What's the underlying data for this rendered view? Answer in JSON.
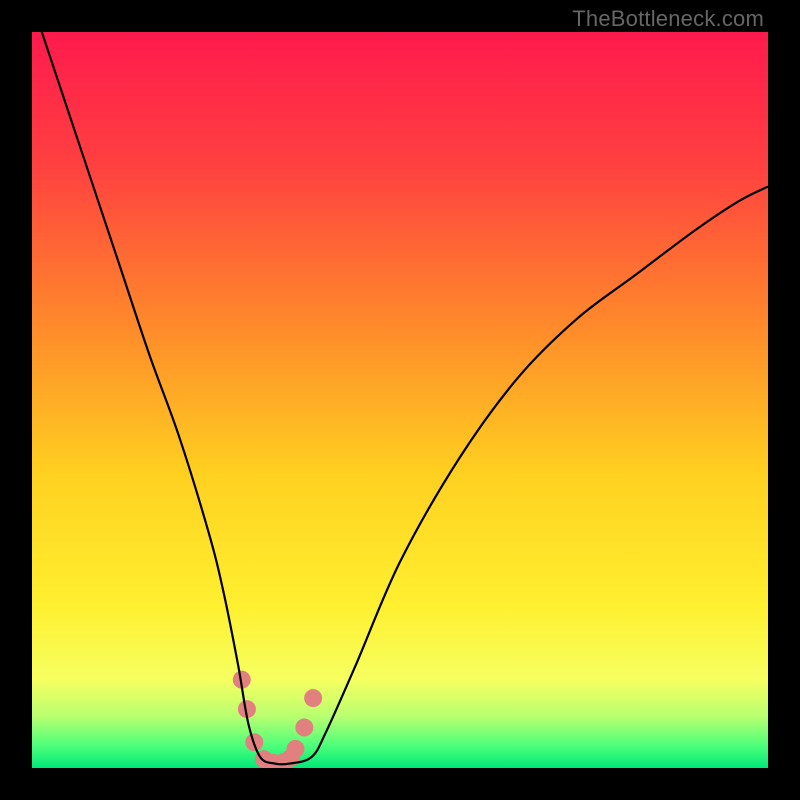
{
  "watermark": "TheBottleneck.com",
  "chart_data": {
    "type": "line",
    "title": "",
    "xlabel": "",
    "ylabel": "",
    "xlim": [
      0,
      100
    ],
    "ylim": [
      0,
      100
    ],
    "background_gradient": {
      "stops": [
        {
          "pos": 0.0,
          "color": "#ff1a4d"
        },
        {
          "pos": 0.18,
          "color": "#ff4040"
        },
        {
          "pos": 0.4,
          "color": "#ff8a2a"
        },
        {
          "pos": 0.6,
          "color": "#ffd020"
        },
        {
          "pos": 0.78,
          "color": "#fff030"
        },
        {
          "pos": 0.88,
          "color": "#f6ff60"
        },
        {
          "pos": 0.93,
          "color": "#b8ff70"
        },
        {
          "pos": 0.97,
          "color": "#4dff7a"
        },
        {
          "pos": 1.0,
          "color": "#00e878"
        }
      ]
    },
    "series": [
      {
        "name": "curve",
        "color": "#000000",
        "x": [
          1,
          4,
          8,
          12,
          16,
          20,
          24,
          26,
          28,
          29.4,
          31,
          33,
          35,
          38,
          40,
          44,
          50,
          58,
          66,
          74,
          82,
          90,
          96,
          100
        ],
        "y": [
          101,
          92,
          80,
          68,
          56,
          45,
          32,
          24,
          14,
          6,
          1.5,
          0.6,
          0.6,
          1.5,
          5,
          14,
          28,
          42,
          53,
          61,
          67,
          73,
          77,
          79
        ]
      }
    ],
    "markers": {
      "name": "highlight-dots",
      "color": "#e28080",
      "radius": 9,
      "x": [
        28.5,
        29.2,
        30.2,
        31.5,
        32.8,
        34.2,
        35.2,
        35.8,
        37.0,
        38.2
      ],
      "y": [
        12.0,
        8.0,
        3.5,
        1.2,
        0.7,
        0.8,
        1.4,
        2.6,
        5.5,
        9.5
      ]
    }
  }
}
